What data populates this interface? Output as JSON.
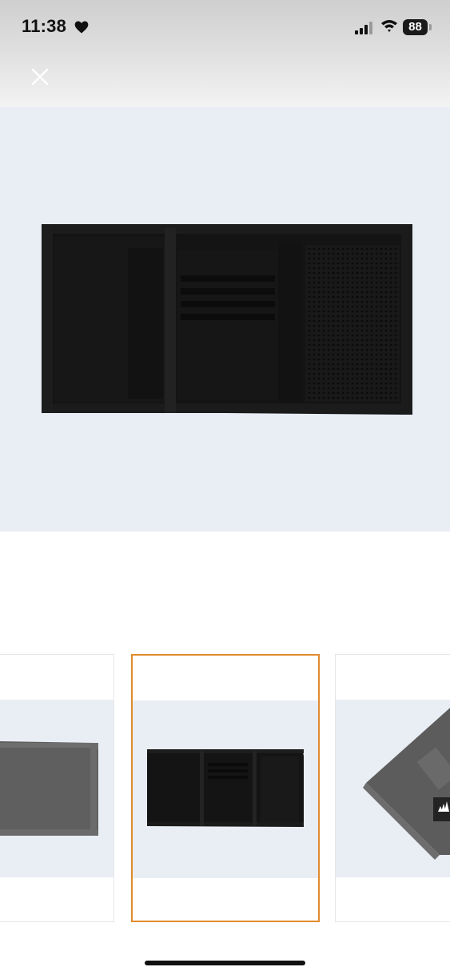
{
  "status_bar": {
    "time": "11:38",
    "battery_level": "88",
    "icons": [
      "heart-icon",
      "cellular-signal-icon",
      "wifi-icon",
      "battery-icon"
    ]
  },
  "toolbar": {
    "close_icon": "close-icon"
  },
  "gallery": {
    "selected_index": 1,
    "thumbnails": [
      {
        "name": "thumbnail-grey-wallet-closed",
        "selected": false
      },
      {
        "name": "thumbnail-black-wallet-open",
        "selected": true
      },
      {
        "name": "thumbnail-grey-wallet-angled",
        "selected": false
      }
    ]
  },
  "colors": {
    "image_background": "#e9edf4",
    "selected_border": "#e08a2c",
    "wallet_black": "#141414",
    "wallet_grey": "#6a6a6a"
  }
}
